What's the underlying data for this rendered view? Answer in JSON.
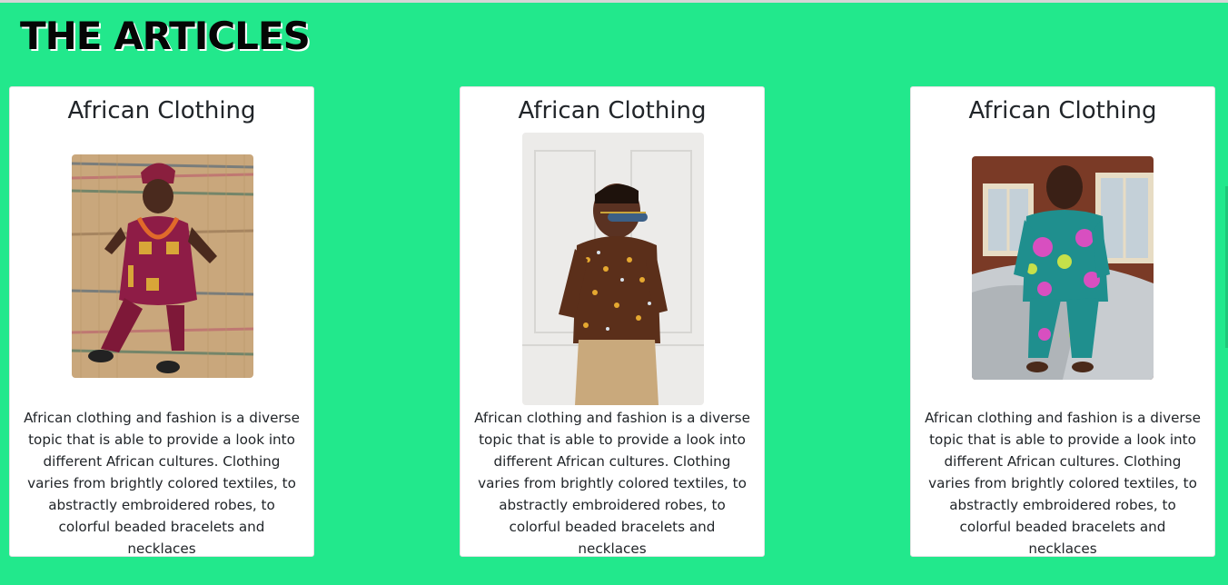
{
  "page": {
    "title": "THE ARTICLES",
    "background_color": "#22e88c"
  },
  "articles": [
    {
      "title": "African Clothing",
      "image": "boy-in-maroon-embroidered-agbada-photo",
      "text": "African clothing and fashion is a diverse topic that is able to provide a look into different African cultures. Clothing varies from brightly colored textiles, to abstractly embroidered robes, to colorful beaded bracelets and necklaces"
    },
    {
      "title": "African Clothing",
      "image": "boy-in-print-shirt-and-sunglasses-photo",
      "text": "African clothing and fashion is a diverse topic that is able to provide a look into different African cultures. Clothing varies from brightly colored textiles, to abstractly embroidered robes, to colorful beaded bracelets and necklaces"
    },
    {
      "title": "African Clothing",
      "image": "boy-in-teal-floral-outfit-photo",
      "text": "African clothing and fashion is a diverse topic that is able to provide a look into different African cultures. Clothing varies from brightly colored textiles, to abstractly embroidered robes, to colorful beaded bracelets and necklaces"
    }
  ]
}
